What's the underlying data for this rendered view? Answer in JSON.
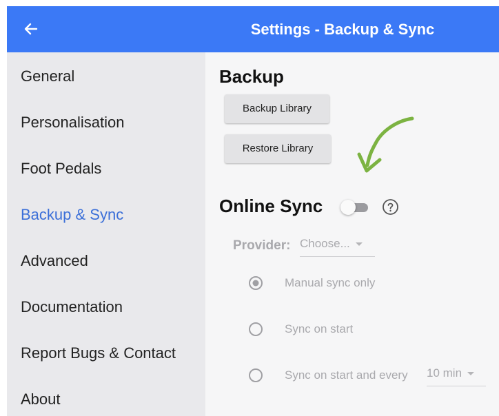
{
  "appbar": {
    "title": "Settings - Backup & Sync",
    "back_icon": "arrow-left-icon"
  },
  "sidebar": {
    "items": [
      {
        "label": "General"
      },
      {
        "label": "Personalisation"
      },
      {
        "label": "Foot Pedals"
      },
      {
        "label": "Backup & Sync",
        "active": true
      },
      {
        "label": "Advanced"
      },
      {
        "label": "Documentation"
      },
      {
        "label": "Report Bugs & Contact"
      },
      {
        "label": "About"
      }
    ]
  },
  "backup": {
    "heading": "Backup",
    "backup_button": "Backup Library",
    "restore_button": "Restore Library"
  },
  "online_sync": {
    "heading": "Online Sync",
    "enabled": false,
    "help_icon": "question-circle-icon"
  },
  "provider": {
    "label": "Provider:",
    "value": "Choose..."
  },
  "sync_options": [
    {
      "label": "Manual sync only",
      "selected": true
    },
    {
      "label": "Sync on start",
      "selected": false
    },
    {
      "label": "Sync on start and every",
      "selected": false
    }
  ],
  "interval": {
    "value": "10 min"
  },
  "colors": {
    "accent": "#3b79f6",
    "active_nav": "#3b6fd8",
    "annotation_arrow": "#7cb342"
  }
}
